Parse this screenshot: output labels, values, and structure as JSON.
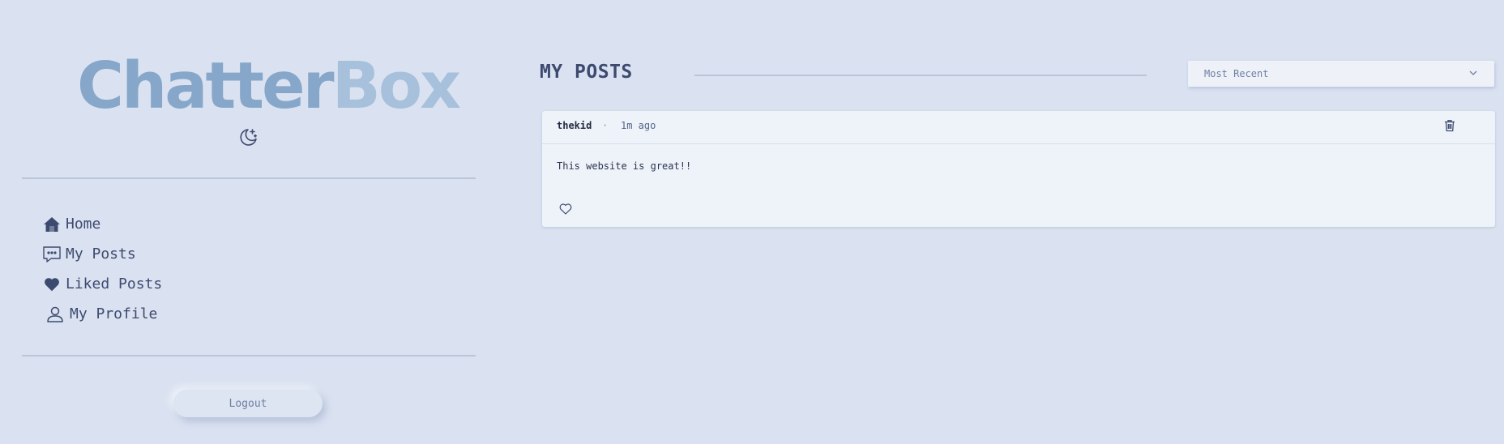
{
  "app": {
    "logo_part1": "Chatter",
    "logo_part2": "Box"
  },
  "sidebar": {
    "items": [
      {
        "label": "Home",
        "icon": "home-icon"
      },
      {
        "label": "My Posts",
        "icon": "chat-bubble-icon"
      },
      {
        "label": "Liked Posts",
        "icon": "heart-icon"
      },
      {
        "label": "My Profile",
        "icon": "user-icon"
      }
    ],
    "logout_label": "Logout",
    "theme_icon": "moon-stars-icon"
  },
  "main": {
    "title": "MY POSTS",
    "sort": {
      "selected": "Most Recent"
    },
    "posts": [
      {
        "author": "thekid",
        "separator": "·",
        "time": "1m ago",
        "content": "This website is great!!"
      }
    ]
  },
  "colors": {
    "background": "#dae2f1",
    "card": "#eef3f9",
    "text": "#3d4a6f",
    "logo_primary": "#86a7c9",
    "logo_secondary": "#a7c0db"
  }
}
